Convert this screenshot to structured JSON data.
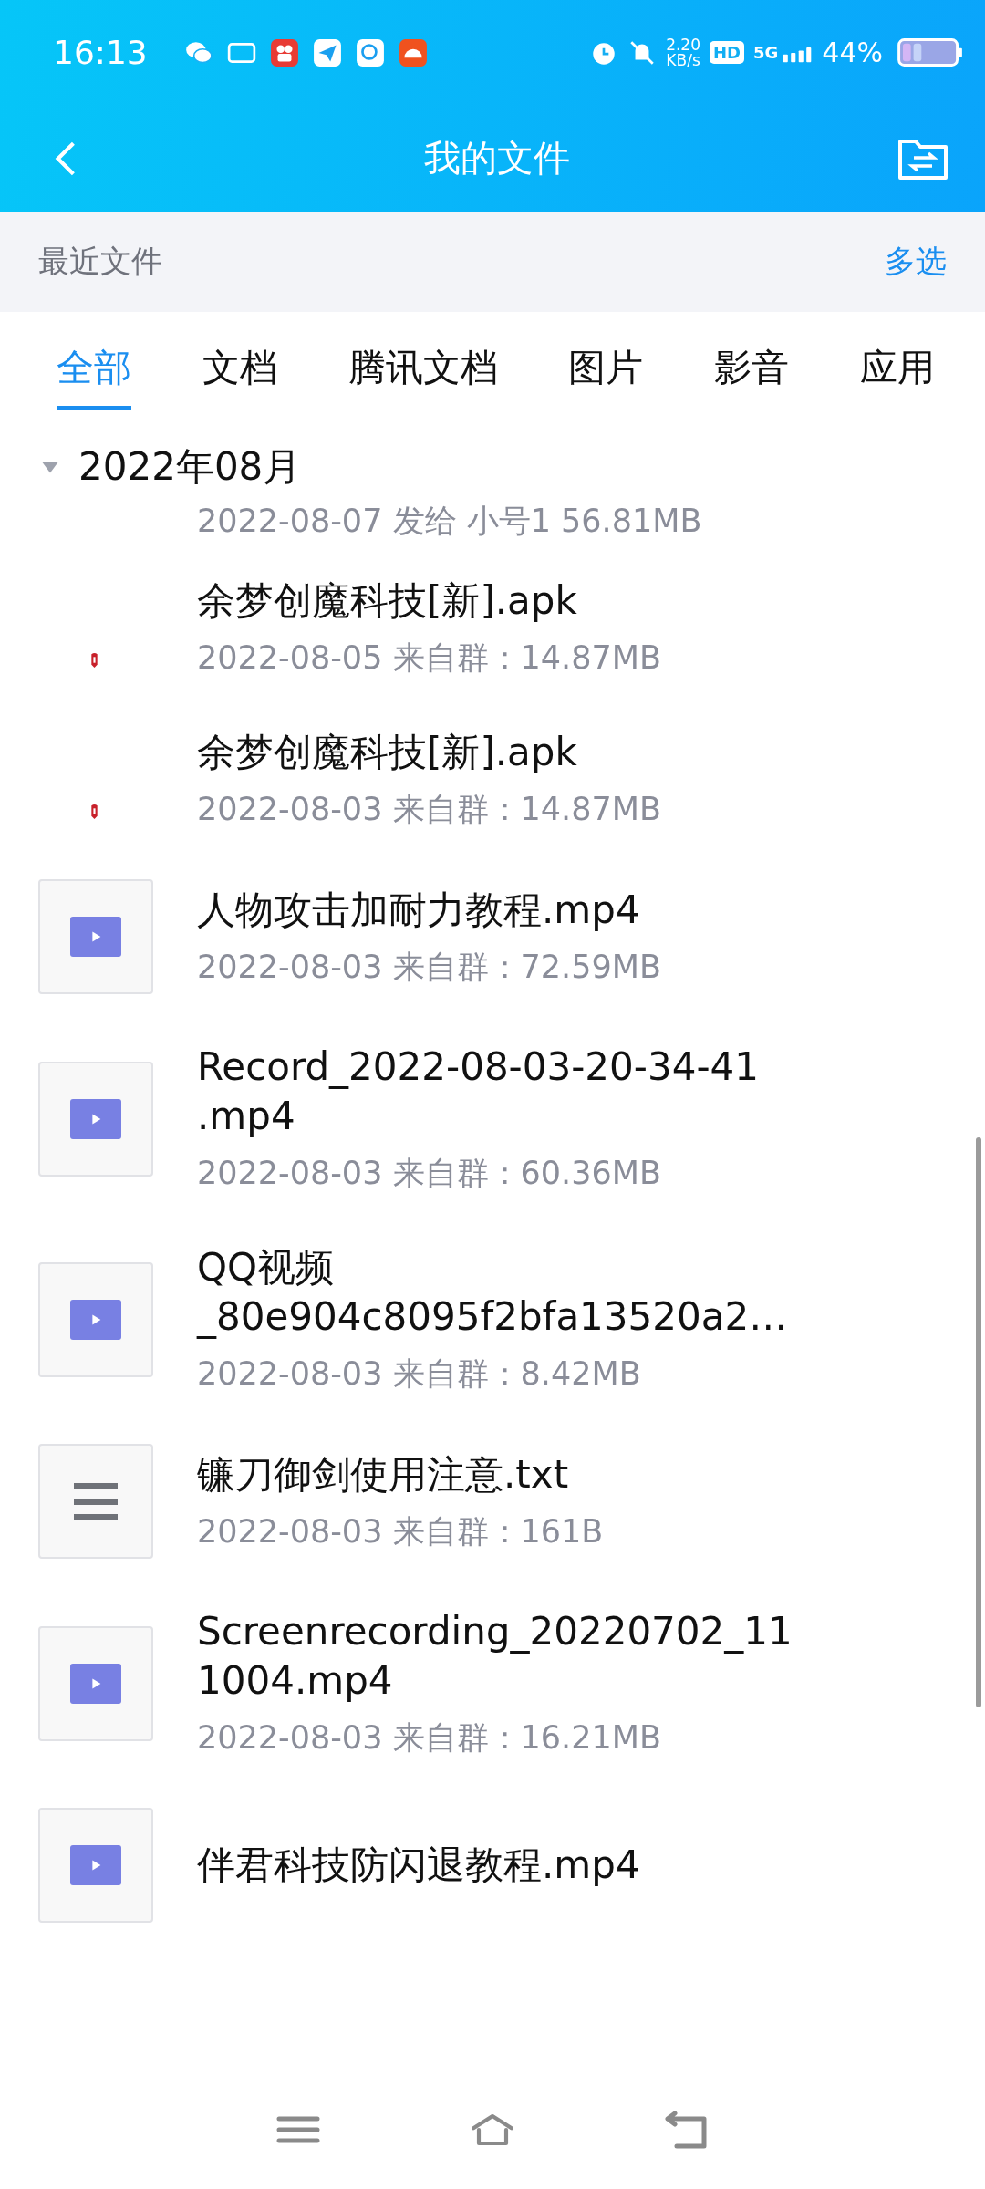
{
  "status_bar": {
    "time": "16:13",
    "speed_value": "2.20",
    "speed_unit": "KB/s",
    "hd": "HD",
    "network": "5G",
    "battery": "44%"
  },
  "header": {
    "title": "我的文件"
  },
  "recent_bar": {
    "label": "最近文件",
    "action": "多选"
  },
  "tabs": [
    {
      "label": "全部",
      "selected": true
    },
    {
      "label": "文档",
      "selected": false
    },
    {
      "label": "腾讯文档",
      "selected": false
    },
    {
      "label": "图片",
      "selected": false
    },
    {
      "label": "影音",
      "selected": false
    },
    {
      "label": "应用",
      "selected": false
    }
  ],
  "section": {
    "title": "2022年08月",
    "expanded": true
  },
  "files": [
    {
      "kind": "none",
      "meta": "2022-08-07  发给 小号1  56.81MB"
    },
    {
      "kind": "apk",
      "name_lines": [
        "余梦创魔科技[新].apk"
      ],
      "meta": "2022-08-05  来自群：14.87MB"
    },
    {
      "kind": "apk",
      "name_lines": [
        "余梦创魔科技[新].apk"
      ],
      "meta": "2022-08-03  来自群：14.87MB"
    },
    {
      "kind": "video",
      "name_lines": [
        "人物攻击加耐力教程.mp4"
      ],
      "meta": "2022-08-03  来自群：72.59MB"
    },
    {
      "kind": "video",
      "name_lines": [
        "Record_2022-08-03-20-34-41",
        ".mp4"
      ],
      "meta": "2022-08-03  来自群：60.36MB"
    },
    {
      "kind": "video",
      "name_lines": [
        "QQ视频",
        "_80e904c8095f2bfa13520a2…"
      ],
      "meta": "2022-08-03  来自群：8.42MB"
    },
    {
      "kind": "text",
      "name_lines": [
        "镰刀御剑使用注意.txt"
      ],
      "meta": "2022-08-03  来自群：161B"
    },
    {
      "kind": "video",
      "name_lines": [
        "Screenrecording_20220702_11",
        "1004.mp4"
      ],
      "meta": "2022-08-03  来自群：16.21MB"
    },
    {
      "kind": "video",
      "name_lines": [
        "伴君科技防闪退教程.mp4"
      ]
    }
  ]
}
